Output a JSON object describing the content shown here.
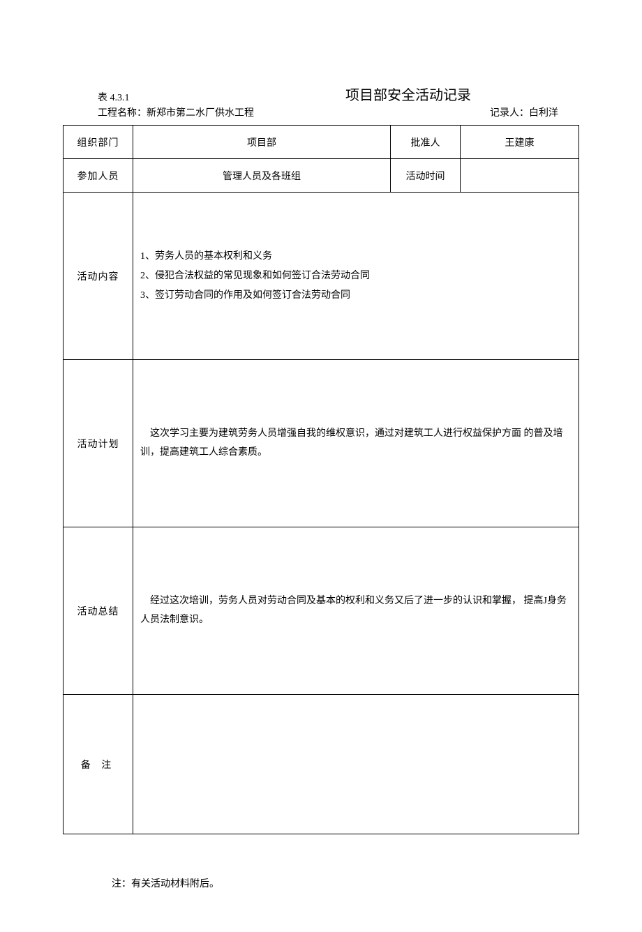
{
  "header": {
    "table_number": "表 4.3.1",
    "title": "项目部安全活动记录",
    "project_label": "工程名称：",
    "project_name": "新郑市第二水厂供水工程",
    "recorder_label": "记录人：",
    "recorder_name": "白利洋"
  },
  "rows": {
    "org_dept": {
      "label": "组织部门",
      "value": "项目部",
      "approver_label": "批准人",
      "approver_value": "王建康"
    },
    "participants": {
      "label": "参加人员",
      "value": "管理人员及各班组",
      "time_label": "活动时间",
      "time_value": ""
    },
    "content": {
      "label": "活动内容",
      "line1": "1、劳务人员的基本权利和义务",
      "line2": "2、侵犯合法权益的常见现象和如何签订合法劳动合同",
      "line3": "3、签订劳动合同的作用及如何签订合法劳动合同"
    },
    "plan": {
      "label": "活动计划",
      "text": "这次学习主要为建筑劳务人员增强自我的维权意识，通过对建筑工人进行权益保护方面 的普及培训，提高建筑工人综合素质。"
    },
    "summary": {
      "label": "活动总结",
      "text": "经过这次培训，劳务人员对劳动合同及基本的权利和义务又后了进一步的认识和掌握，  提高J身务人员法制意识。"
    },
    "remark": {
      "label": "备 注",
      "text": ""
    }
  },
  "footer": {
    "note": "注：有关活动材料附后。"
  }
}
